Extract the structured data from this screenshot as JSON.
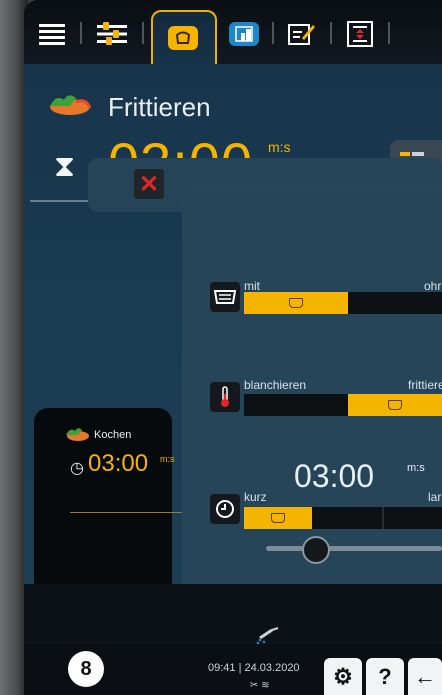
{
  "header": {
    "tabs": [
      {
        "name": "menu",
        "icon": "hamburger-icon"
      },
      {
        "name": "modes",
        "icon": "sliders-icon"
      },
      {
        "name": "cooking",
        "icon": "pot-icon",
        "active": true
      },
      {
        "name": "view",
        "icon": "panel-icon"
      },
      {
        "name": "edit",
        "icon": "edit-icon"
      },
      {
        "name": "program",
        "icon": "program-icon"
      }
    ]
  },
  "main": {
    "title": "Frittieren",
    "title_icon": "vegetables-icon",
    "time": "03:00",
    "time_unit": "m:s"
  },
  "settings": {
    "row1": {
      "icon": "basket-icon",
      "left_label": "mit",
      "right_label": "ohr",
      "active_segment": 1
    },
    "row2": {
      "icon": "thermometer-icon",
      "left_label": "blanchieren",
      "right_label": "frittiere",
      "active_segment": 2
    },
    "row3": {
      "icon": "timer-icon",
      "time": "03:00",
      "time_unit": "m:s",
      "left_label": "kurz",
      "right_label": "lar",
      "active_segment": 1
    }
  },
  "side": {
    "title": "Kochen",
    "time": "03:00",
    "time_unit": "m:s"
  },
  "status": {
    "step": "8",
    "clock": "09:41 | 24.03.2020",
    "icons": "✂ ≋"
  },
  "colors": {
    "accent": "#f4b400",
    "panel": "#17344b",
    "cancel": "#e0262a"
  }
}
